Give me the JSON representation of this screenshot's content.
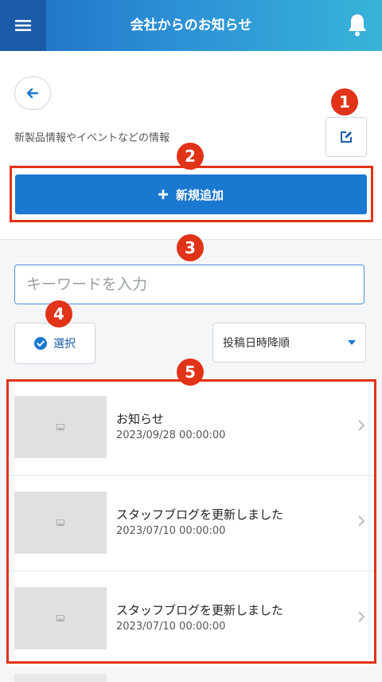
{
  "header": {
    "title": "会社からのお知らせ"
  },
  "description": "新製品情報やイベントなどの情報",
  "add_button_label": "新規追加",
  "search": {
    "placeholder": "キーワードを入力",
    "value": ""
  },
  "select_button_label": "選択",
  "sort": {
    "selected": "投稿日時降順"
  },
  "items": [
    {
      "title": "お知らせ",
      "date": "2023/09/28 00:00:00"
    },
    {
      "title": "スタッフブログを更新しました",
      "date": "2023/07/10 00:00:00"
    },
    {
      "title": "スタッフブログを更新しました",
      "date": "2023/07/10 00:00:00"
    }
  ],
  "callouts": [
    "1",
    "2",
    "3",
    "4",
    "5"
  ],
  "colors": {
    "header_start": "#1f6fc4",
    "header_end": "#38b4d8",
    "primary": "#1a78d0",
    "callout": "#e03318"
  }
}
